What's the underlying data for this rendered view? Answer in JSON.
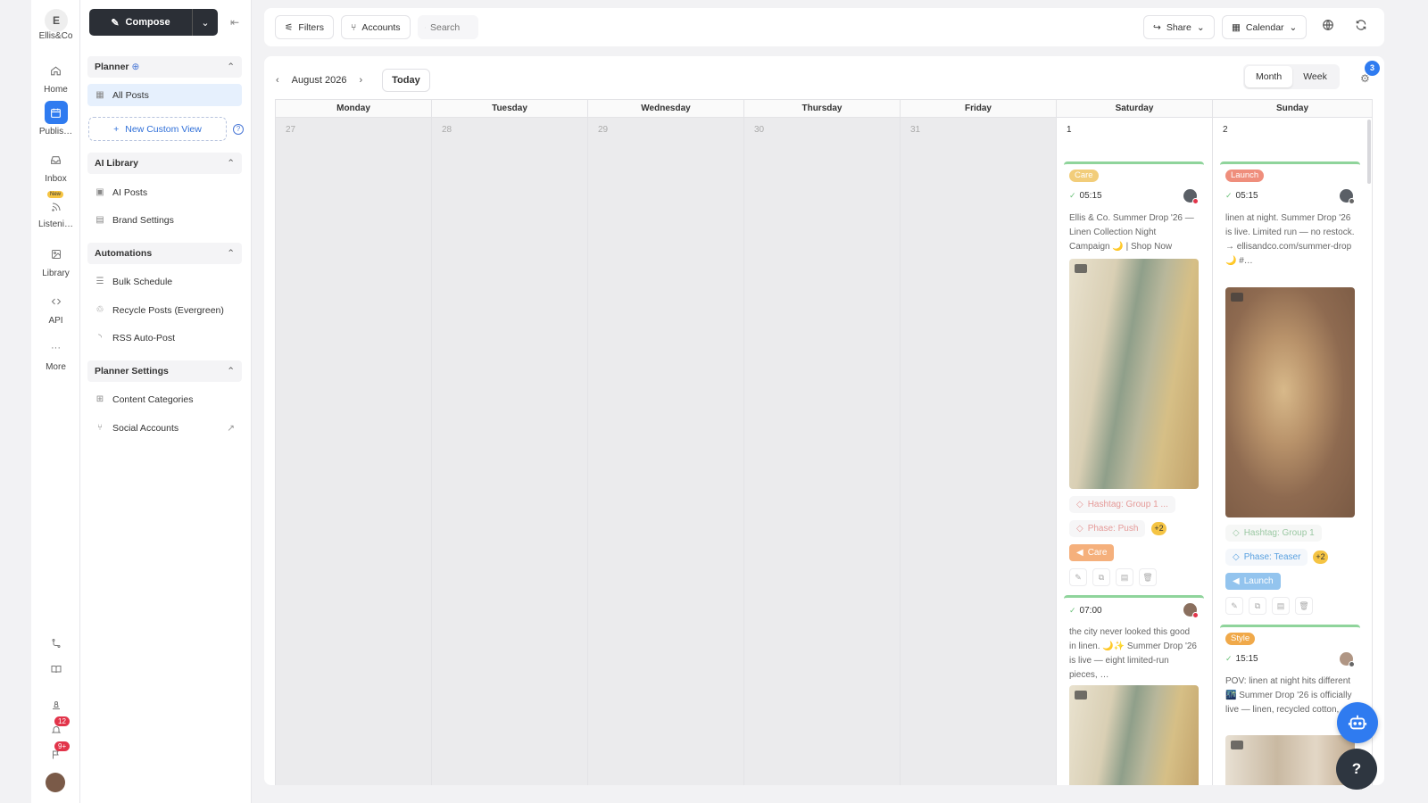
{
  "rail": {
    "logo": "E",
    "brand": "Ellis&Co",
    "items": [
      {
        "label": "Home",
        "icon": "home-icon"
      },
      {
        "label": "Publis…",
        "icon": "calendar-icon"
      },
      {
        "label": "Inbox",
        "icon": "inbox-icon"
      },
      {
        "label": "Listeni…",
        "icon": "rss-icon",
        "badge": "New"
      },
      {
        "label": "Library",
        "icon": "library-icon"
      },
      {
        "label": "API",
        "icon": "code-icon"
      },
      {
        "label": "More",
        "icon": "more-icon"
      }
    ],
    "notifications_count": "12",
    "messages_count": "9+"
  },
  "sidebar": {
    "compose_label": "Compose",
    "sections": {
      "planner": {
        "title": "Planner",
        "items": [
          "All Posts"
        ],
        "new_view": "New Custom View"
      },
      "ai_library": {
        "title": "AI Library",
        "items": [
          "AI Posts",
          "Brand Settings"
        ]
      },
      "automations": {
        "title": "Automations",
        "items": [
          "Bulk Schedule",
          "Recycle Posts (Evergreen)",
          "RSS Auto-Post"
        ]
      },
      "planner_settings": {
        "title": "Planner Settings",
        "items": [
          "Content Categories",
          "Social Accounts"
        ]
      }
    }
  },
  "topbar": {
    "filters": "Filters",
    "accounts": "Accounts",
    "search_placeholder": "Search",
    "share": "Share",
    "calendar": "Calendar"
  },
  "calendar": {
    "month_label": "August 2026",
    "today": "Today",
    "view_month": "Month",
    "view_week": "Week",
    "settings_badge": "3",
    "days": [
      "Monday",
      "Tuesday",
      "Wednesday",
      "Thursday",
      "Friday",
      "Saturday",
      "Sunday"
    ],
    "dates": [
      "27",
      "28",
      "29",
      "30",
      "31",
      "1",
      "2"
    ]
  },
  "posts": {
    "sat1": {
      "tag": "Care",
      "time": "05:15",
      "text": "Ellis & Co. Summer Drop '26 — Linen Collection Night Campaign 🌙 | Shop Now",
      "chip1": "Hashtag: Group 1 ...",
      "chip2": "Phase: Push",
      "more": "+2",
      "campaign": "Care"
    },
    "sat2": {
      "time": "07:00",
      "text": "the city never looked this good in linen. 🌙✨ Summer Drop '26 is live — eight limited-run pieces, …"
    },
    "sun1": {
      "tag": "Launch",
      "time": "05:15",
      "text": "linen at night. Summer Drop '26 is live. Limited run — no restock. → ellisandco.com/summer-drop 🌙 #…",
      "chip1": "Hashtag: Group 1",
      "chip2": "Phase: Teaser",
      "more": "+2",
      "campaign": "Launch"
    },
    "sun2": {
      "tag": "Style",
      "time": "15:15",
      "text": "POV: linen at night hits different 🌃 Summer Drop '26 is officially live — linen, recycled cotton, …"
    }
  },
  "help_label": "?",
  "colors": {
    "accent": "#2f7bf0",
    "care_tag": "#f2cd7a",
    "launch_tag": "#ef8e7c",
    "style_tag": "#f0a94a",
    "care_campaign": "#f5b07c",
    "launch_campaign": "#93c4ee"
  }
}
